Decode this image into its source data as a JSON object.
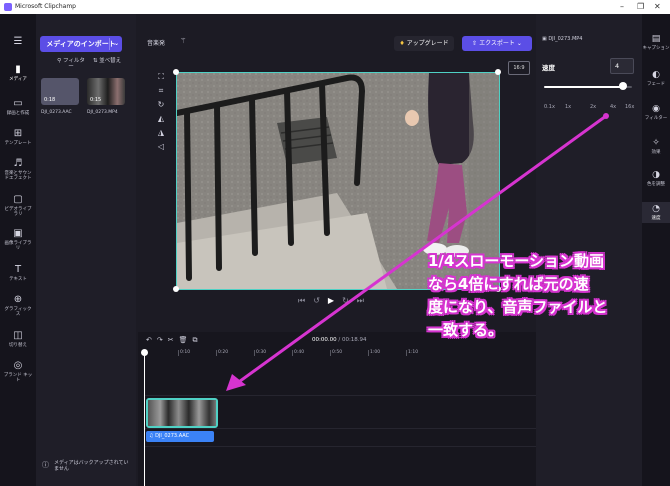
{
  "window": {
    "title": "Microsoft Clipchamp",
    "controls": [
      "–",
      "❐",
      "✕"
    ]
  },
  "leftnav": {
    "items": [
      {
        "icon": "menu-icon",
        "glyph": "☰",
        "label": ""
      },
      {
        "icon": "media-icon",
        "glyph": "▮",
        "label": "メディア"
      },
      {
        "icon": "record-icon",
        "glyph": "▭",
        "label": "録画と作成"
      },
      {
        "icon": "template-icon",
        "glyph": "⊞",
        "label": "テンプレート"
      },
      {
        "icon": "music-icon",
        "glyph": "♬",
        "label": "音楽とサウンドエフェクト"
      },
      {
        "icon": "video-library-icon",
        "glyph": "▢",
        "label": "ビデオライブラリ"
      },
      {
        "icon": "image-library-icon",
        "glyph": "▣",
        "label": "画像ライブラリ"
      },
      {
        "icon": "text-icon",
        "glyph": "T",
        "label": "テキスト"
      },
      {
        "icon": "graphics-icon",
        "glyph": "⊕",
        "label": "グラフィックス"
      },
      {
        "icon": "transition-icon",
        "glyph": "◫",
        "label": "切り替え"
      },
      {
        "icon": "brand-kit-icon",
        "glyph": "◎",
        "label": "ブランド キット"
      }
    ]
  },
  "media": {
    "import_label": "メディアのインポート",
    "filter_label": "フィルター",
    "sort_label": "並べ替え",
    "items": [
      {
        "name": "DJI_0273.AAC",
        "duration": "0:18"
      },
      {
        "name": "DJI_0273.MP4",
        "duration": "0:15"
      }
    ],
    "backup_note": "メディアはバックアップされていません"
  },
  "toolbar": {
    "audio_label": "音楽発",
    "upgrade_label": "アップグレード",
    "export_label": "エクスポート",
    "aspect_ratio": "16:9"
  },
  "timeline": {
    "current": "00:00.00",
    "total": "/ 00:18.94",
    "ticks": [
      "0:10",
      "0:20",
      "0:30",
      "0:40",
      "0:50",
      "1:00",
      "1:10"
    ],
    "audio_clip_label": "DJI_0273.AAC"
  },
  "speed_panel": {
    "file": "DJI_0273.MP4",
    "title": "速度",
    "value": "4",
    "slider_labels": [
      "0.1x",
      "1x",
      "2x",
      "4x",
      "16x"
    ],
    "slider_position": 0.9
  },
  "rightnav": {
    "items": [
      {
        "icon": "caption-icon",
        "glyph": "▤",
        "label": "キャプション"
      },
      {
        "icon": "fade-icon",
        "glyph": "◐",
        "label": "フェード"
      },
      {
        "icon": "filter-icon",
        "glyph": "◉",
        "label": "フィルター"
      },
      {
        "icon": "effects-icon",
        "glyph": "✧",
        "label": "効果"
      },
      {
        "icon": "color-adjust-icon",
        "glyph": "◑",
        "label": "色を調整"
      },
      {
        "icon": "speed-icon",
        "glyph": "◔",
        "label": "速度"
      }
    ]
  },
  "annotation": {
    "lines": [
      "1/4スローモーション動画",
      "なら4倍にすれば元の速",
      "度になり、音声ファイルと",
      "一致する。"
    ],
    "color": "#d634d0"
  }
}
